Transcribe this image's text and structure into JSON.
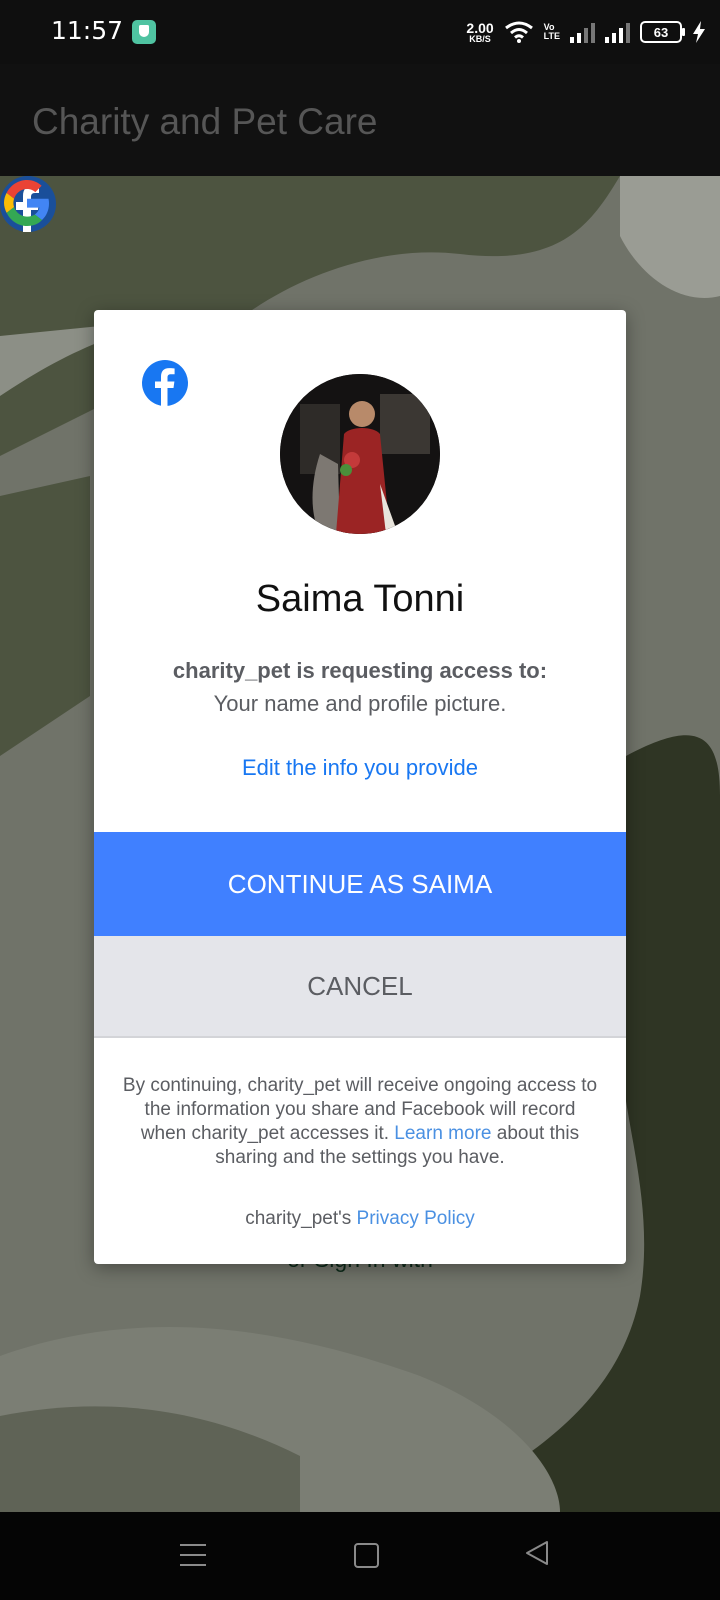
{
  "status_bar": {
    "time": "11:57",
    "net_speed_value": "2.00",
    "net_speed_unit": "KB/S",
    "volte_top": "Vo",
    "volte_bottom": "LTE",
    "battery": "63",
    "icons": [
      "shield-app-icon",
      "wifi-icon",
      "signal-icon",
      "battery-icon",
      "charging-icon"
    ]
  },
  "app_bar": {
    "title": "Charity and Pet Care"
  },
  "background": {
    "or_sign_in": "or Sign In with",
    "social_icons": [
      "facebook-icon",
      "google-icon"
    ]
  },
  "dialog": {
    "user_name": "Saima Tonni",
    "request_line": "charity_pet is requesting access to:",
    "request_detail": "Your name and profile picture.",
    "edit_link": "Edit the info you provide",
    "continue_label": "CONTINUE AS SAIMA",
    "cancel_label": "CANCEL",
    "disclaimer_text": "By continuing, charity_pet will receive ongoing access to the information you share and Facebook will record when charity_pet accesses it.",
    "learn_more": "Learn more",
    "disclaimer_tail": "about this sharing and the settings you have.",
    "privacy_prefix": "charity_pet's",
    "privacy_link": "Privacy Policy"
  },
  "colors": {
    "facebook_blue": "#1877f2",
    "continue_button": "#4080ff",
    "cancel_button": "#e4e5ea",
    "link": "#4a90e2"
  },
  "nav_bar": {
    "icons": [
      "menu-icon",
      "home-icon",
      "back-icon"
    ]
  }
}
